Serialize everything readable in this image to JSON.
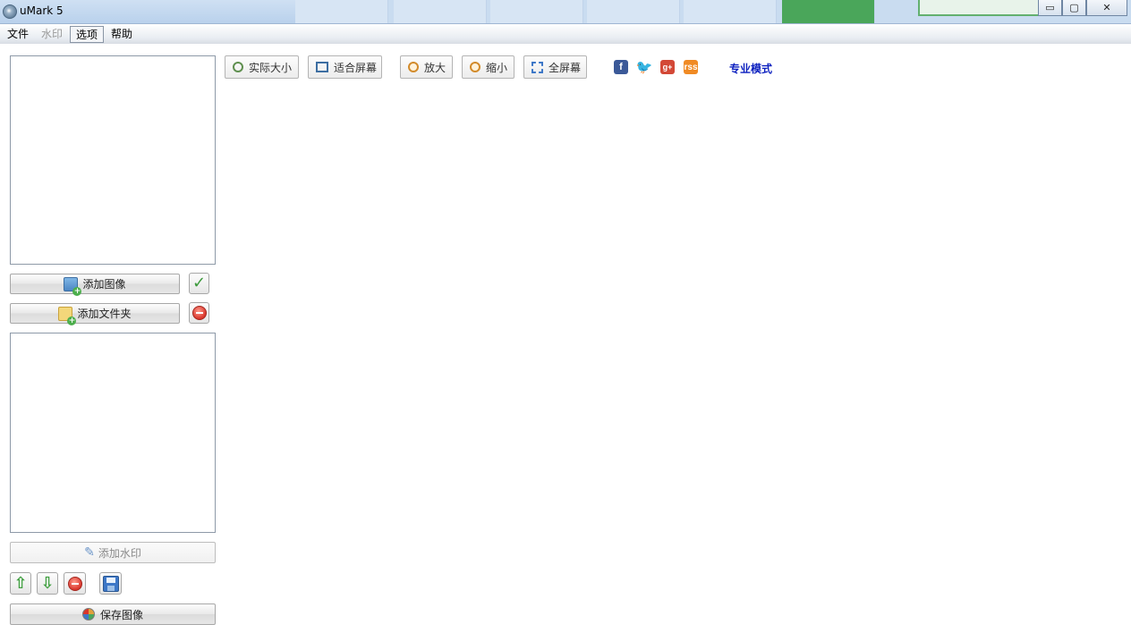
{
  "window": {
    "title": "uMark 5",
    "controls": {
      "minimize": "▭",
      "maximize": "▢",
      "close": "✕"
    }
  },
  "menu": {
    "items": [
      {
        "label": "文件",
        "state": "normal"
      },
      {
        "label": "水印",
        "state": "disabled"
      },
      {
        "label": "选项",
        "state": "active"
      },
      {
        "label": "帮助",
        "state": "normal"
      }
    ]
  },
  "sidebar": {
    "add_image_label": "添加图像",
    "add_folder_label": "添加文件夹",
    "add_watermark_label": "添加水印",
    "save_image_label": "保存图像"
  },
  "toolbar": {
    "actual_size": "实际大小",
    "fit_screen": "适合屏幕",
    "zoom_in": "放大",
    "zoom_out": "缩小",
    "full_screen": "全屏幕",
    "pro_mode": "专业模式"
  },
  "social": {
    "facebook": "f",
    "twitter": "🐦",
    "googleplus": "g+",
    "rss": "rss"
  },
  "colors": {
    "link": "#0b1fbf",
    "accent_green": "#3c9a3c",
    "danger_red": "#d9352b"
  }
}
